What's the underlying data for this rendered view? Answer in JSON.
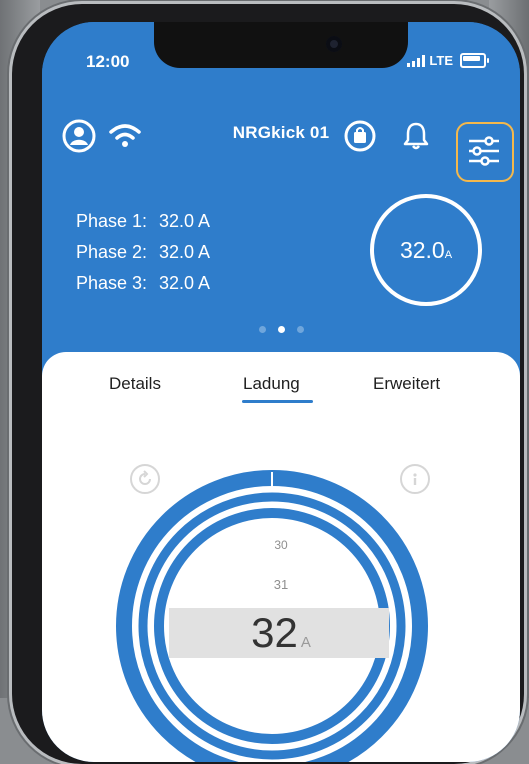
{
  "status_bar": {
    "time": "12:00",
    "network": "LTE"
  },
  "header": {
    "title": "NRGkick 01"
  },
  "phases": [
    {
      "label": "Phase 1:",
      "value": "32.0 A"
    },
    {
      "label": "Phase 2:",
      "value": "32.0 A"
    },
    {
      "label": "Phase 3:",
      "value": "32.0 A"
    }
  ],
  "current_display": {
    "value": "32.0",
    "unit": "A"
  },
  "pager": {
    "page_count": 3,
    "active_page": 2
  },
  "tabs": [
    {
      "label": "Details",
      "active": false
    },
    {
      "label": "Ladung",
      "active": true
    },
    {
      "label": "Erweitert",
      "active": false
    }
  ],
  "picker": {
    "values_above": [
      "30",
      "31"
    ],
    "selected": "32",
    "unit": "A"
  },
  "colors": {
    "primary": "#2f7dcb",
    "highlight": "#f4b84c",
    "sheet": "#ffffff"
  }
}
